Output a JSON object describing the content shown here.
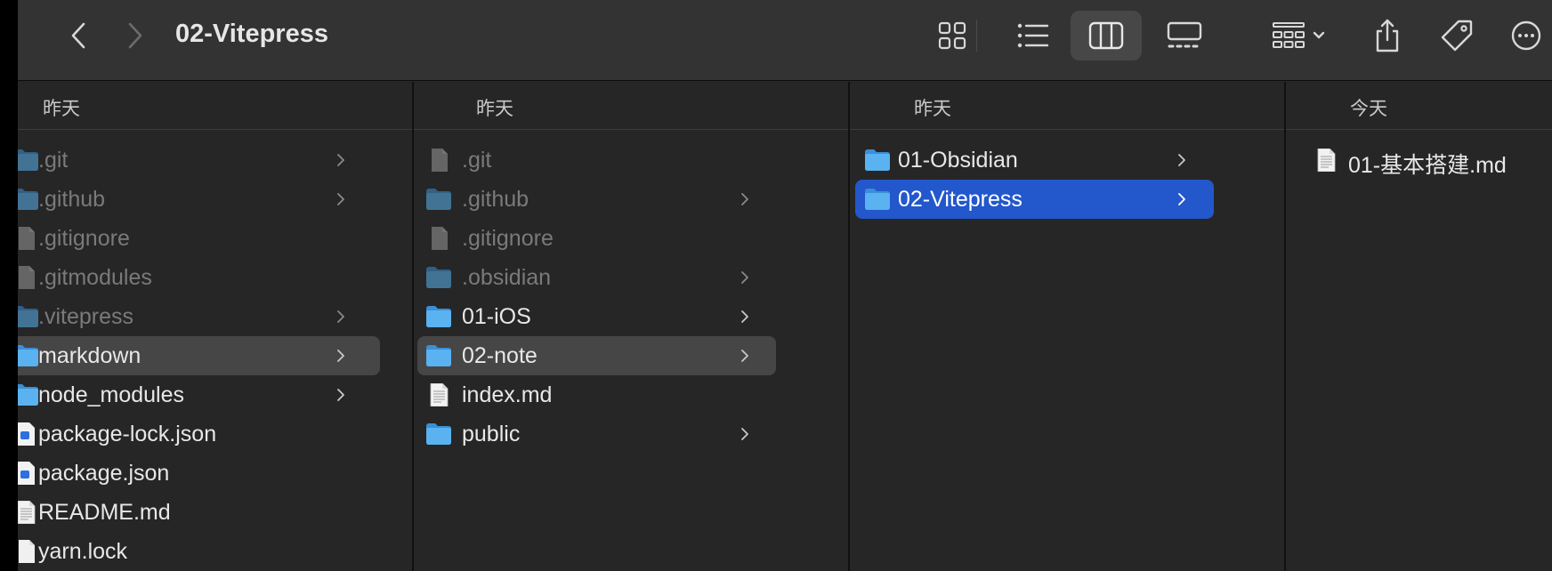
{
  "window": {
    "title": "02-Vitepress"
  },
  "toolbar": {
    "back_icon": "chevron-left-icon",
    "forward_icon": "chevron-right-icon",
    "view_modes": [
      "icon-view-icon",
      "list-view-icon",
      "column-view-icon",
      "gallery-view-icon"
    ],
    "selected_view": "column-view-icon",
    "actions": [
      "group-by-icon",
      "share-icon",
      "tag-icon",
      "more-icon"
    ]
  },
  "columns": [
    {
      "header": "昨天",
      "items": [
        {
          "name": ".git",
          "kind": "folder",
          "hidden": true,
          "chevron": true
        },
        {
          "name": ".github",
          "kind": "folder",
          "hidden": true,
          "chevron": true
        },
        {
          "name": ".gitignore",
          "kind": "file",
          "hidden": true,
          "chevron": false
        },
        {
          "name": ".gitmodules",
          "kind": "file",
          "hidden": true,
          "chevron": false
        },
        {
          "name": ".vitepress",
          "kind": "folder",
          "hidden": true,
          "chevron": true
        },
        {
          "name": "markdown",
          "kind": "folder",
          "hidden": false,
          "chevron": true,
          "state": "path"
        },
        {
          "name": "node_modules",
          "kind": "folder",
          "hidden": false,
          "chevron": true
        },
        {
          "name": "package-lock.json",
          "kind": "json",
          "hidden": false,
          "chevron": false
        },
        {
          "name": "package.json",
          "kind": "json",
          "hidden": false,
          "chevron": false
        },
        {
          "name": "README.md",
          "kind": "doc",
          "hidden": false,
          "chevron": false
        },
        {
          "name": "yarn.lock",
          "kind": "file-white",
          "hidden": false,
          "chevron": false
        }
      ]
    },
    {
      "header": "昨天",
      "items": [
        {
          "name": ".git",
          "kind": "file",
          "hidden": true,
          "chevron": false
        },
        {
          "name": ".github",
          "kind": "folder",
          "hidden": true,
          "chevron": true
        },
        {
          "name": ".gitignore",
          "kind": "file",
          "hidden": true,
          "chevron": false
        },
        {
          "name": ".obsidian",
          "kind": "folder",
          "hidden": true,
          "chevron": true
        },
        {
          "name": "01-iOS",
          "kind": "folder",
          "hidden": false,
          "chevron": true
        },
        {
          "name": "02-note",
          "kind": "folder",
          "hidden": false,
          "chevron": true,
          "state": "path"
        },
        {
          "name": "index.md",
          "kind": "doc",
          "hidden": false,
          "chevron": false
        },
        {
          "name": "public",
          "kind": "folder",
          "hidden": false,
          "chevron": true
        }
      ]
    },
    {
      "header": "昨天",
      "items": [
        {
          "name": "01-Obsidian",
          "kind": "folder",
          "hidden": false,
          "chevron": true
        },
        {
          "name": "02-Vitepress",
          "kind": "folder",
          "hidden": false,
          "chevron": true,
          "state": "selected"
        }
      ]
    },
    {
      "header": "今天",
      "items": [
        {
          "name": "01-基本搭建.md",
          "kind": "doc",
          "hidden": false,
          "chevron": false
        }
      ]
    }
  ],
  "colors": {
    "selection": "#2357cc",
    "path_highlight": "#464646",
    "folder": "#5ab2f0"
  }
}
